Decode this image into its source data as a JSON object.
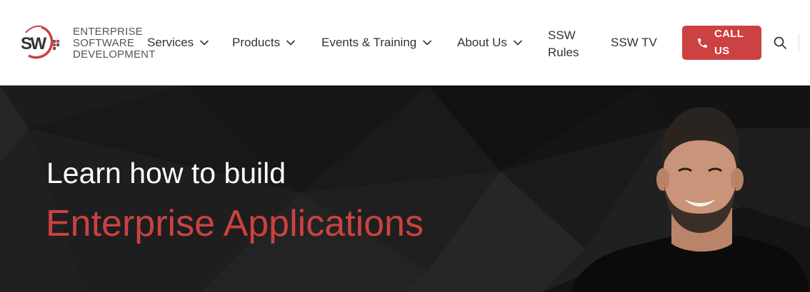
{
  "header": {
    "logo": {
      "mark_text": "SSW",
      "tagline": [
        "ENTERPRISE",
        "SOFTWARE",
        "DEVELOPMENT"
      ]
    },
    "nav": [
      {
        "label": "Services",
        "has_dropdown": true
      },
      {
        "label": "Products",
        "has_dropdown": true
      },
      {
        "label": "Events & Training",
        "has_dropdown": true
      },
      {
        "label": "About Us",
        "has_dropdown": true
      },
      {
        "label_lines": [
          "SSW",
          "Rules"
        ],
        "has_dropdown": false
      },
      {
        "label": "SSW TV",
        "has_dropdown": false
      }
    ],
    "call_button": {
      "label": "CALL US",
      "icon": "phone-icon"
    },
    "search_icon": "search-icon"
  },
  "hero": {
    "line1": "Learn how to build",
    "line2": "Enterprise Applications"
  },
  "colors": {
    "brand_red": "#cc4141",
    "nav_text": "#333333",
    "hero_bg": "#141414",
    "hero_line1": "#ffffff"
  }
}
